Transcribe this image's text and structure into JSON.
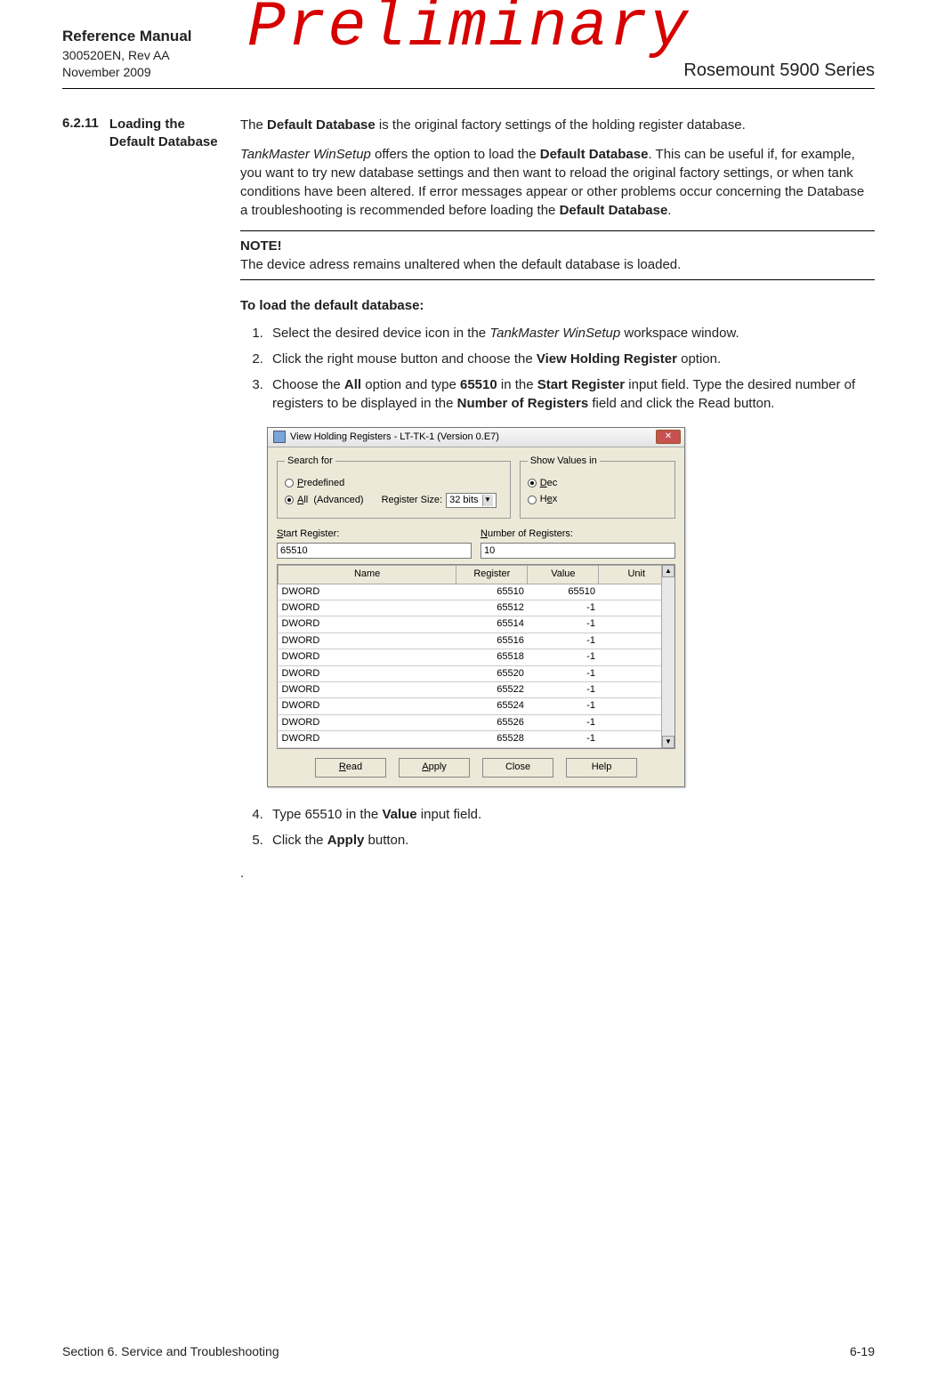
{
  "watermark": "Preliminary",
  "header": {
    "title": "Reference Manual",
    "docnum": "300520EN, Rev AA",
    "date": "November 2009",
    "product": "Rosemount 5900 Series"
  },
  "section": {
    "number": "6.2.11",
    "title": "Loading the Default Database"
  },
  "body": {
    "p1a": "The ",
    "p1b": "Default Database",
    "p1c": " is the original factory settings of the holding register database.",
    "p2a": "TankMaster WinSetup",
    "p2b": " offers the option to load the ",
    "p2c": "Default Database",
    "p2d": ". This can be useful if, for example, you want to try new database settings and then want to reload the original factory settings, or when tank conditions have been altered. If error messages appear or other problems occur concerning the Database a troubleshooting is recommended before loading the ",
    "p2e": "Default Database",
    "p2f": ".",
    "note_label": "NOTE!",
    "note_text": "The device adress remains unaltered when the default database is loaded.",
    "proc_title": "To load the default database:",
    "step1a": "Select the desired device icon in the ",
    "step1b": "TankMaster WinSetup",
    "step1c": " workspace window.",
    "step2a": "Click the right mouse button and choose the ",
    "step2b": "View Holding Register",
    "step2c": " option.",
    "step3a": "Choose the ",
    "step3b": "All",
    "step3c": " option and type ",
    "step3d": "65510",
    "step3e": " in the ",
    "step3f": "Start Register",
    "step3g": " input field. Type the desired number of registers to be displayed in the ",
    "step3h": "Number of Registers",
    "step3i": " field and click the Read button.",
    "step4a": "Type 65510 in the ",
    "step4b": "Value",
    "step4c": " input field.",
    "step5a": "Click the ",
    "step5b": "Apply",
    "step5c": " button."
  },
  "dialog": {
    "title": "View Holding Registers - LT-TK-1 (Version 0.E7)",
    "group_search": "Search for",
    "group_show": "Show Values in",
    "radio_predefined": "Predefined",
    "radio_all": "All  (Advanced)",
    "radio_dec": "Dec",
    "radio_hex": "Hex",
    "regsize_label": "Register Size:",
    "regsize_value": "32 bits",
    "start_label": "Start Register:",
    "start_value": "65510",
    "num_label": "Number of Registers:",
    "num_value": "10",
    "col_name": "Name",
    "col_register": "Register",
    "col_value": "Value",
    "col_unit": "Unit",
    "rows": [
      {
        "name": "DWORD",
        "reg": "65510",
        "val": "65510",
        "unit": ""
      },
      {
        "name": "DWORD",
        "reg": "65512",
        "val": "-1",
        "unit": ""
      },
      {
        "name": "DWORD",
        "reg": "65514",
        "val": "-1",
        "unit": ""
      },
      {
        "name": "DWORD",
        "reg": "65516",
        "val": "-1",
        "unit": ""
      },
      {
        "name": "DWORD",
        "reg": "65518",
        "val": "-1",
        "unit": ""
      },
      {
        "name": "DWORD",
        "reg": "65520",
        "val": "-1",
        "unit": ""
      },
      {
        "name": "DWORD",
        "reg": "65522",
        "val": "-1",
        "unit": ""
      },
      {
        "name": "DWORD",
        "reg": "65524",
        "val": "-1",
        "unit": ""
      },
      {
        "name": "DWORD",
        "reg": "65526",
        "val": "-1",
        "unit": ""
      },
      {
        "name": "DWORD",
        "reg": "65528",
        "val": "-1",
        "unit": ""
      }
    ],
    "btn_read": "Read",
    "btn_apply": "Apply",
    "btn_close": "Close",
    "btn_help": "Help"
  },
  "footer": {
    "left": "Section 6. Service and Troubleshooting",
    "right": "6-19"
  }
}
